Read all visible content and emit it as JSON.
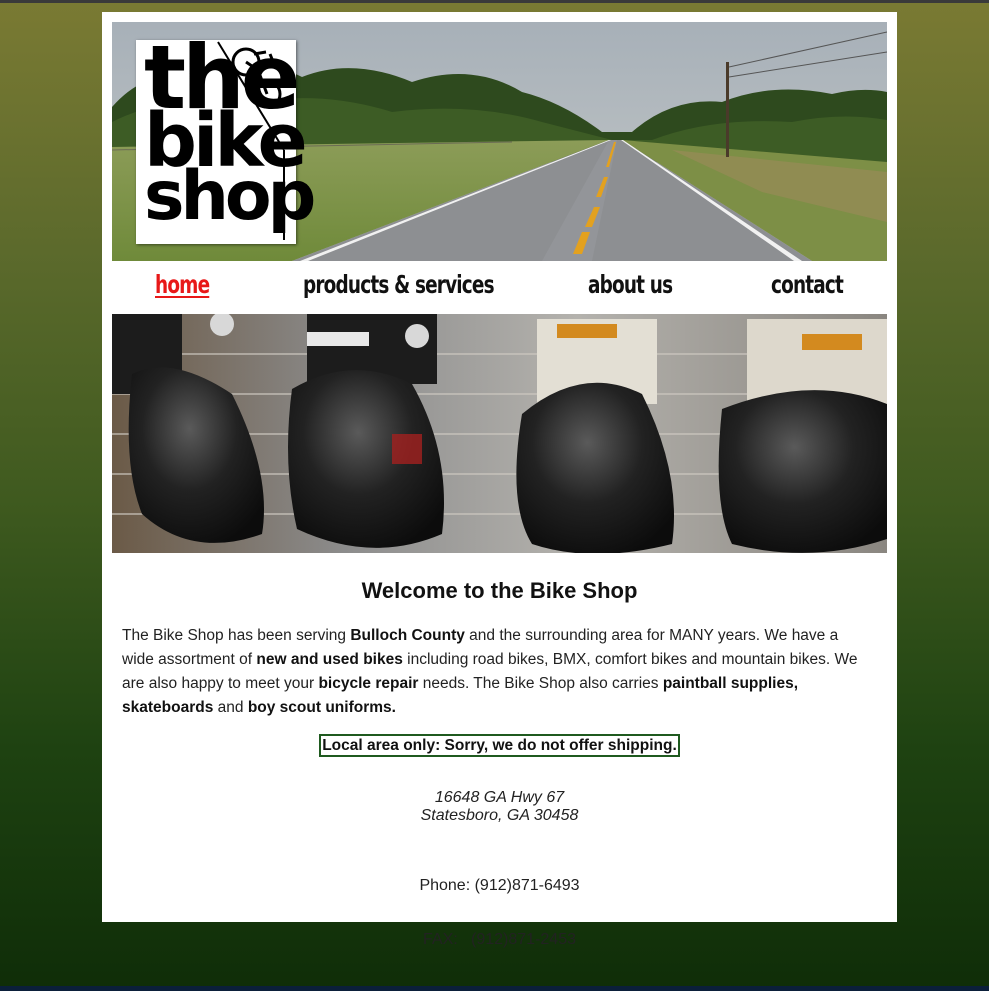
{
  "logo": {
    "line1": "the",
    "line2": "bike",
    "line3": "shop"
  },
  "nav": [
    {
      "label": "home",
      "active": true
    },
    {
      "label": "products & services",
      "active": false
    },
    {
      "label": "about us",
      "active": false
    },
    {
      "label": "contact",
      "active": false
    }
  ],
  "main": {
    "title": "Welcome to the Bike Shop",
    "intro": {
      "t1": "The Bike Shop has been serving ",
      "b1": "Bulloch County",
      "t2": " and the surrounding area for MANY years. We have a wide assortment of ",
      "b2": "new and used bikes",
      "t3": " including road bikes, BMX, comfort bikes and mountain bikes. We are also happy to meet your ",
      "b3": "bicycle repair",
      "t4": " needs. The Bike Shop also carries ",
      "b4": "paintball supplies, skateboards",
      "t5": " and ",
      "b5": "boy scout uniforms."
    },
    "notice": "Local area only: Sorry, we do not offer shipping.",
    "address": {
      "line1": "16648 GA Hwy 67",
      "line2": "Statesboro, GA 30458"
    },
    "phone": "Phone: (912)871-6493",
    "fax": "FAX:   (912)871-2453"
  },
  "colors": {
    "nav_active": "#e81818",
    "notice_border": "#1f5a1f"
  }
}
